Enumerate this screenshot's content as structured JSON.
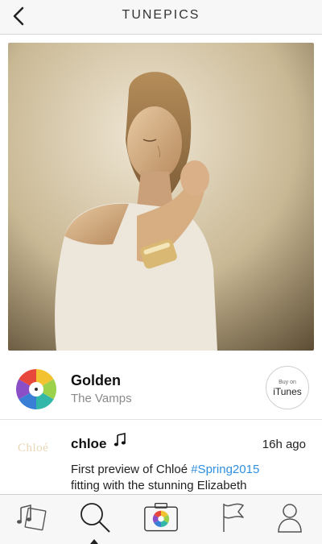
{
  "header": {
    "title": "TUNEPICS",
    "back_icon": "chevron-left-icon"
  },
  "song": {
    "title": "Golden",
    "artist": "The Vamps",
    "itunes_button": {
      "small_text": "Buy on",
      "big_text": "iTunes"
    }
  },
  "post": {
    "brand_logo": "Chloé",
    "username": "chloe",
    "time": "16h ago",
    "caption_prefix": "First preview of Chloé ",
    "hashtag": "#Spring2015",
    "caption_line2": "fitting with the stunning Elizabeth"
  },
  "tabbar": {
    "tabs": [
      {
        "icon": "music-card-icon"
      },
      {
        "icon": "search-icon",
        "active": true
      },
      {
        "icon": "camera-icon"
      },
      {
        "icon": "flag-icon"
      },
      {
        "icon": "profile-icon"
      }
    ]
  },
  "colors": {
    "accent": "#2f8fe0",
    "muted": "#8a8a8a"
  }
}
